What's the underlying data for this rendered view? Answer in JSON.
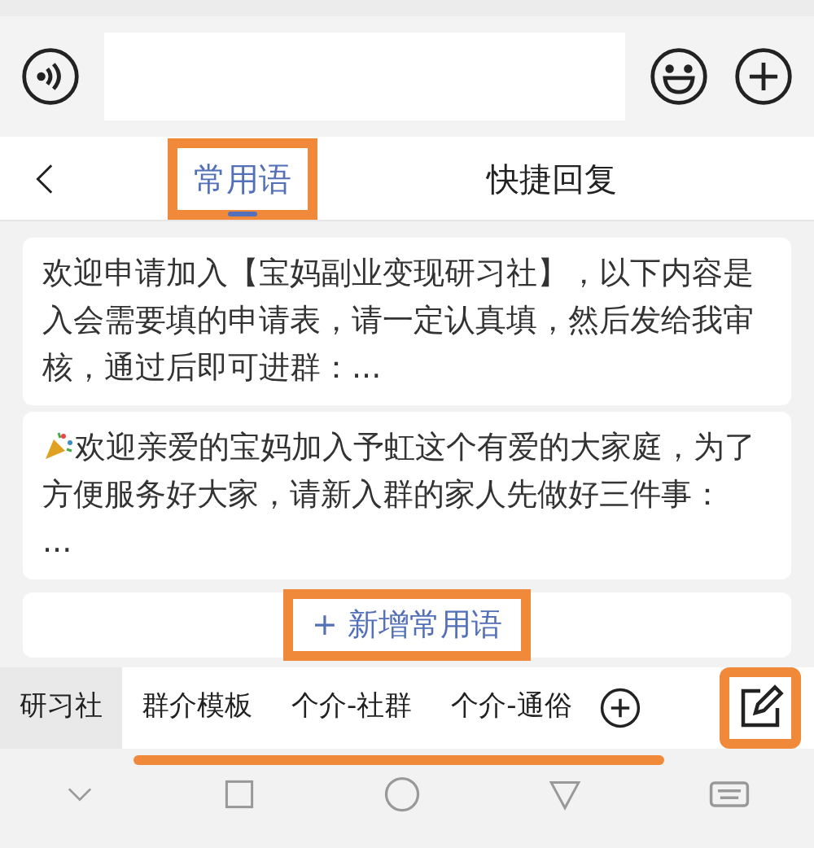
{
  "tabs": [
    {
      "label": "常用语",
      "selected": true,
      "highlighted": true
    },
    {
      "label": "快捷回复",
      "selected": false,
      "highlighted": false
    }
  ],
  "phrases": [
    {
      "text": "欢迎申请加入【宝妈副业变现研习社】，以下内容是入会需要填的申请表，请一定认真填，然后发给我审核，通过后即可进群：...",
      "leading_icon": false
    },
    {
      "text": "欢迎亲爱的宝妈加入予虹这个有爱的大家庭，为了方便服务好大家，请新入群的家人先做好三件事：\n...",
      "leading_icon": true
    }
  ],
  "add_button": {
    "label": "+ 新增常用语",
    "highlighted": true
  },
  "categories": [
    {
      "label": "研习社",
      "selected": true
    },
    {
      "label": "群介模板",
      "selected": false
    },
    {
      "label": "个介-社群",
      "selected": false
    },
    {
      "label": "个介-通俗",
      "selected": false
    }
  ],
  "categories_underlined": true,
  "edit_button": {
    "highlighted": true
  }
}
